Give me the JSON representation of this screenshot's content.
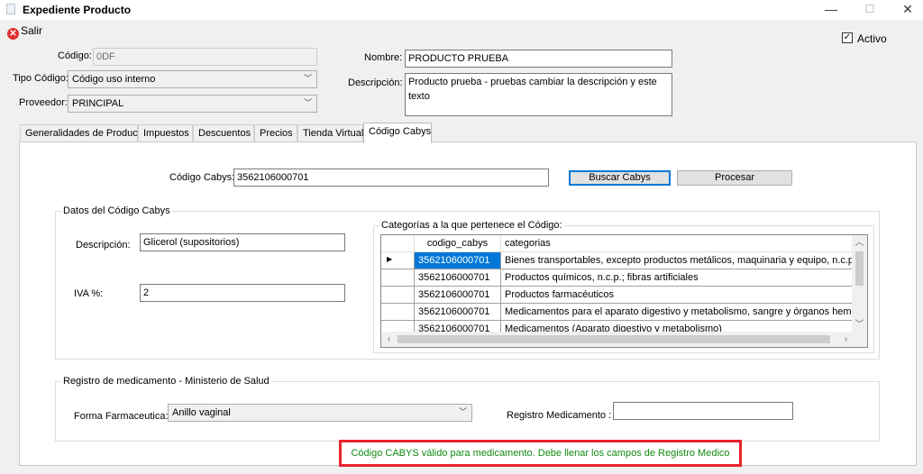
{
  "window": {
    "title": "Expediente Producto",
    "minimize": "—",
    "maximize": "☐",
    "close": "✕"
  },
  "toolbar": {
    "exit_label": "Salir"
  },
  "form": {
    "codigo_label": "Código:",
    "codigo_value": "0DF",
    "tipo_codigo_label": "Tipo Código:",
    "tipo_codigo_value": "Código uso interno",
    "proveedor_label": "Proveedor:",
    "proveedor_value": "PRINCIPAL",
    "nombre_label": "Nombre:",
    "nombre_value": "PRODUCTO PRUEBA",
    "descripcion_label": "Descripción:",
    "descripcion_value": "Producto prueba - pruebas cambiar la descripción y este texto",
    "activo_label": "Activo",
    "activo_checked": true
  },
  "tabs": [
    {
      "label": "Generalidades de Producto"
    },
    {
      "label": "Impuestos"
    },
    {
      "label": "Descuentos"
    },
    {
      "label": "Precios"
    },
    {
      "label": "Tienda Virtual"
    },
    {
      "label": "Código Cabys"
    }
  ],
  "cabys": {
    "codigo_label": "Código Cabys:",
    "codigo_value": "3562106000701",
    "buscar_label": "Buscar Cabys",
    "procesar_label": "Procesar",
    "datos_group_title": "Datos del Código Cabys",
    "descripcion_label": "Descripción:",
    "descripcion_value": "Glicerol (supositorios)",
    "iva_label": "IVA %:",
    "iva_value": "2",
    "categorias_group_title": "Categorías a la que pertenece el Código:",
    "grid": {
      "columns": [
        "codigo_cabys",
        "categorias"
      ],
      "rows": [
        {
          "codigo": "3562106000701",
          "categoria": "Bienes transportables, excepto productos metálicos, maquinaria y equipo, n.c.p."
        },
        {
          "codigo": "3562106000701",
          "categoria": "Productos químicos, n.c.p.; fibras artificiales"
        },
        {
          "codigo": "3562106000701",
          "categoria": "Productos farmacéuticos"
        },
        {
          "codigo": "3562106000701",
          "categoria": "Medicamentos para el aparato digestivo y metabolismo, sangre y órganos hematopoyé"
        },
        {
          "codigo": "3562106000701",
          "categoria": "Medicamentos (Aparato digestivo y metabolismo)"
        }
      ],
      "current_row_marker": "▶"
    }
  },
  "registro": {
    "group_title": "Registro de medicamento - Ministerio de Salud",
    "forma_label": "Forma Farmaceutica:",
    "forma_value": "Anillo vaginal",
    "registro_label": "Registro Medicamento :",
    "registro_value": ""
  },
  "status": {
    "message": "Código CABYS válido para medicamento. Debe llenar los campos de Registro Medico",
    "message_color": "#128a12",
    "highlight_color": "#e8232e"
  }
}
